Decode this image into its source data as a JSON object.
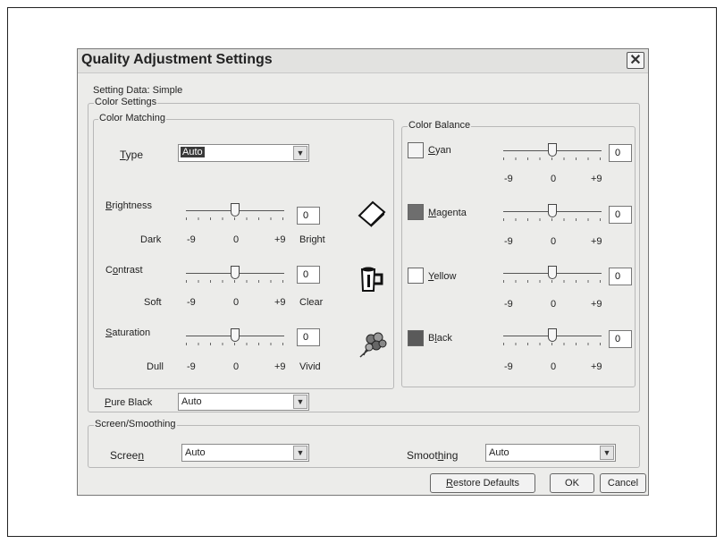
{
  "dialog": {
    "title": "Quality Adjustment Settings",
    "close_glyph": "✕",
    "setting_data": "Setting Data: Simple"
  },
  "color_settings": {
    "group_label": "Color Settings",
    "color_matching": {
      "group_label": "Color Matching",
      "type": {
        "label_first": "T",
        "label_rest": "ype",
        "value": "Auto"
      },
      "brightness": {
        "label_first": "B",
        "label_rest": "rightness",
        "value": "0",
        "left": "Dark",
        "right": "Bright",
        "min": "-9",
        "mid": "0",
        "max": "+9",
        "level": 0
      },
      "contrast": {
        "label_pre": "C",
        "label_ul": "o",
        "label_rest": "ntrast",
        "value": "0",
        "left": "Soft",
        "right": "Clear",
        "min": "-9",
        "mid": "0",
        "max": "+9",
        "level": 0
      },
      "saturation": {
        "label_first": "S",
        "label_rest": "aturation",
        "value": "0",
        "left": "Dull",
        "right": "Vivid",
        "min": "-9",
        "mid": "0",
        "max": "+9",
        "level": 0
      }
    },
    "pure_black": {
      "label_first": "P",
      "label_rest": "ure Black",
      "value": "Auto"
    },
    "color_balance": {
      "group_label": "Color Balance",
      "cyan": {
        "label_first": "C",
        "label_rest": "yan",
        "value": "0",
        "min": "-9",
        "mid": "0",
        "max": "+9",
        "level": 0,
        "swatch": "#f4f4f4"
      },
      "magenta": {
        "label_first": "M",
        "label_rest": "agenta",
        "value": "0",
        "min": "-9",
        "mid": "0",
        "max": "+9",
        "level": 0,
        "swatch": "#6e6e6e"
      },
      "yellow": {
        "label_first": "Y",
        "label_rest": "ellow",
        "value": "0",
        "min": "-9",
        "mid": "0",
        "max": "+9",
        "level": 0,
        "swatch": "#ffffff"
      },
      "black": {
        "label_pre": "B",
        "label_ul": "l",
        "label_rest": "ack",
        "value": "0",
        "min": "-9",
        "mid": "0",
        "max": "+9",
        "level": 0,
        "swatch": "#5a5a5a"
      }
    }
  },
  "screen_smoothing": {
    "group_label": "Screen/Smoothing",
    "screen": {
      "label_pre": "Scree",
      "label_ul": "n",
      "value": "Auto"
    },
    "smoothing": {
      "label_pre": "Smoot",
      "label_ul": "h",
      "label_rest": "ing",
      "value": "Auto"
    }
  },
  "buttons": {
    "restore_first": "R",
    "restore_rest": "estore Defaults",
    "ok": "OK",
    "cancel": "Cancel"
  },
  "icons": {
    "brightness": "page-tilted-icon",
    "contrast": "coffee-mug-icon",
    "saturation": "flowers-icon"
  }
}
